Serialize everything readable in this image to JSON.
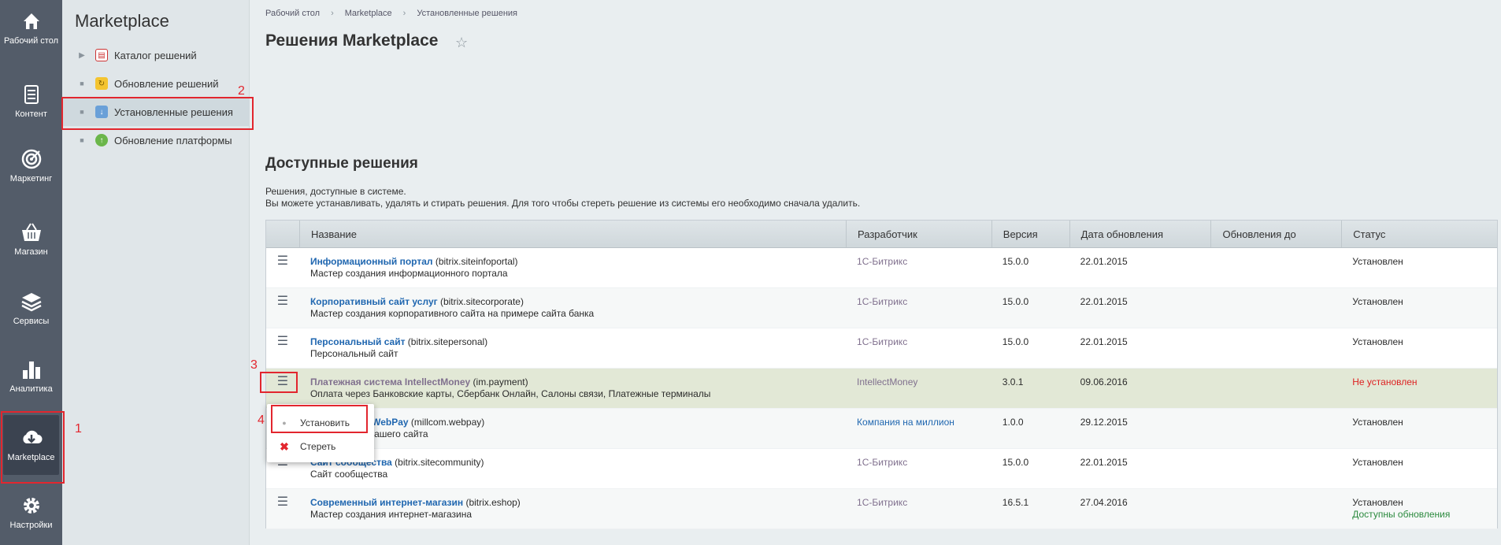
{
  "rail": {
    "items": [
      {
        "label": "Рабочий стол",
        "icon": "home-icon"
      },
      {
        "label": "Контент",
        "icon": "document-icon"
      },
      {
        "label": "Маркетинг",
        "icon": "target-icon"
      },
      {
        "label": "Магазин",
        "icon": "basket-icon"
      },
      {
        "label": "Сервисы",
        "icon": "layers-icon"
      },
      {
        "label": "Аналитика",
        "icon": "bar-chart-icon"
      },
      {
        "label": "Marketplace",
        "icon": "cloud-download-icon"
      },
      {
        "label": "Настройки",
        "icon": "gear-icon"
      }
    ]
  },
  "menu": {
    "title": "Marketplace",
    "items": [
      {
        "label": "Каталог решений",
        "icon": "catalog-icon"
      },
      {
        "label": "Обновление решений",
        "icon": "update-icon"
      },
      {
        "label": "Установленные решения",
        "icon": "installed-icon"
      },
      {
        "label": "Обновление платформы",
        "icon": "platform-update-icon"
      }
    ]
  },
  "breadcrumb": [
    "Рабочий стол",
    "Marketplace",
    "Установленные решения"
  ],
  "breadcrumb_sep": "›",
  "page": {
    "title": "Решения Marketplace",
    "section_title": "Доступные решения",
    "desc_line1": "Решения, доступные в системе.",
    "desc_line2": "Вы можете устанавливать, удалять и стирать решения. Для того чтобы стереть решение из системы его необходимо сначала удалить."
  },
  "grid": {
    "columns": [
      "Название",
      "Разработчик",
      "Версия",
      "Дата обновления",
      "Обновления до",
      "Статус"
    ],
    "rows": [
      {
        "name": "Информационный портал",
        "code": " (bitrix.siteinfoportal)",
        "desc": "Мастер создания информационного портала",
        "dev": "1С-Битрикс",
        "ver": "15.0.0",
        "date": "22.01.2015",
        "upd": "",
        "status": "Установлен",
        "status2": ""
      },
      {
        "name": "Корпоративный сайт услуг",
        "code": " (bitrix.sitecorporate)",
        "desc": "Мастер создания корпоративного сайта на примере сайта банка",
        "dev": "1С-Битрикс",
        "ver": "15.0.0",
        "date": "22.01.2015",
        "upd": "",
        "status": "Установлен",
        "status2": ""
      },
      {
        "name": "Персональный сайт",
        "code": " (bitrix.sitepersonal)",
        "desc": "Персональный сайт",
        "dev": "1С-Битрикс",
        "ver": "15.0.0",
        "date": "22.01.2015",
        "upd": "",
        "status": "Установлен",
        "status2": ""
      },
      {
        "name": "Платежная система IntellectMoney",
        "code": " (im.payment)",
        "desc": "Оплата через Банковские карты, Сбербанк Онлайн, Салоны связи, Платежные терминалы",
        "dev": "IntellectMoney",
        "ver": "3.0.1",
        "date": "09.06.2016",
        "upd": "",
        "status": "Не установлен",
        "status2": ""
      },
      {
        "name": "истема WebPay",
        "code": " (millcom.webpay)",
        "desc": "жи для вашего сайта",
        "dev": "Компания на миллион",
        "ver": "1.0.0",
        "date": "29.12.2015",
        "upd": "",
        "status": "Установлен",
        "status2": ""
      },
      {
        "name": "Сайт сообщества",
        "code": " (bitrix.sitecommunity)",
        "desc": "Сайт сообщества",
        "dev": "1С-Битрикс",
        "ver": "15.0.0",
        "date": "22.01.2015",
        "upd": "",
        "status": "Установлен",
        "status2": ""
      },
      {
        "name": "Современный интернет-магазин",
        "code": " (bitrix.eshop)",
        "desc": "Мастер создания интернет-магазина",
        "dev": "1С-Битрикс",
        "ver": "16.5.1",
        "date": "27.04.2016",
        "upd": "",
        "status": "Установлен",
        "status2": "Доступны обновления"
      }
    ]
  },
  "popup": {
    "install": "Установить",
    "erase": "Стереть"
  },
  "annotations": [
    "1",
    "2",
    "3",
    "4"
  ],
  "colors": {
    "rail": "#535c69",
    "link": "#2067b0",
    "annotation": "#e2262e",
    "not_installed": "#dd2222",
    "updates": "#2b8a3e"
  }
}
